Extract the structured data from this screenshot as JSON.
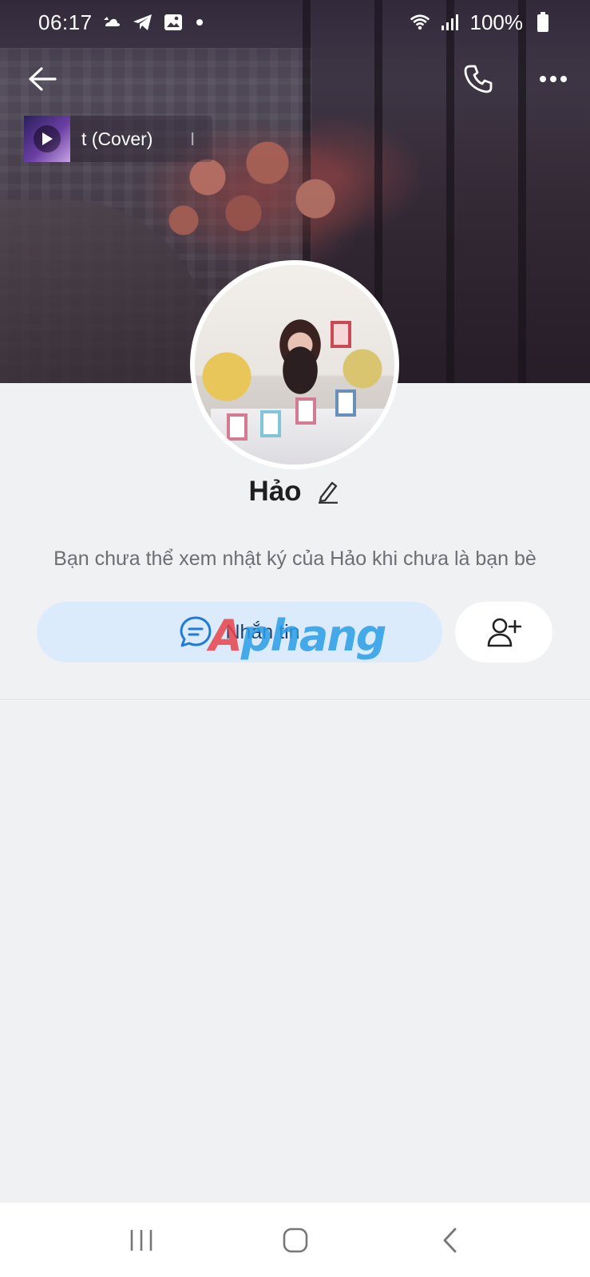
{
  "status_bar": {
    "time": "06:17",
    "battery": "100%",
    "notification_icons": [
      "weather-icon",
      "telegram-icon",
      "gallery-icon",
      "dot-icon"
    ],
    "system_icons": [
      "wifi-icon",
      "signal-icon",
      "battery-icon"
    ]
  },
  "top_bar": {
    "back_icon": "arrow-left-icon",
    "call_icon": "phone-icon",
    "more_icon": "more-horizontal-icon"
  },
  "music": {
    "title_visible": "t (Cover)",
    "title_trailing": "I",
    "play_icon": "play-icon"
  },
  "profile": {
    "name": "Hảo",
    "edit_icon": "pencil-icon",
    "privacy_note": "Bạn chưa thể xem nhật ký của Hảo khi chưa là bạn bè"
  },
  "actions": {
    "message_label": "Nhắn tin",
    "message_icon": "chat-bubble-icon",
    "add_friend_icon": "add-user-icon"
  },
  "watermark": {
    "first_letter": "A",
    "rest": "phang"
  },
  "nav": {
    "recents_icon": "recents-icon",
    "home_icon": "home-icon",
    "back_icon": "nav-back-icon"
  },
  "colors": {
    "page_bg": "#eff1f3",
    "message_button_bg": "#dbebfc",
    "message_text": "#1a3e6b",
    "accent_blue": "#1f7bd6",
    "watermark_red": "#e8434a",
    "watermark_blue": "#2a9ee6"
  }
}
